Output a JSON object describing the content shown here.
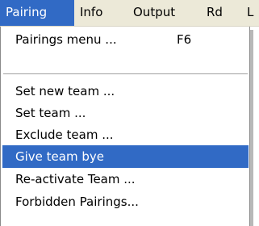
{
  "menubar": {
    "items": [
      {
        "label": "Pairing"
      },
      {
        "label": "Info"
      },
      {
        "label": "Output"
      },
      {
        "label": "Rd"
      },
      {
        "label": "L"
      }
    ]
  },
  "dropdown": {
    "items": [
      {
        "label": "Pairings menu ...",
        "shortcut": "F6"
      },
      {
        "label": "Set new team ..."
      },
      {
        "label": "Set team ..."
      },
      {
        "label": "Exclude team ..."
      },
      {
        "label": "Give team bye"
      },
      {
        "label": "Re-activate Team ..."
      },
      {
        "label": "Forbidden Pairings..."
      }
    ]
  },
  "colors": {
    "menubar_background": "#ece9d8",
    "highlight": "#316ac5",
    "highlight_text": "#ffffff"
  }
}
